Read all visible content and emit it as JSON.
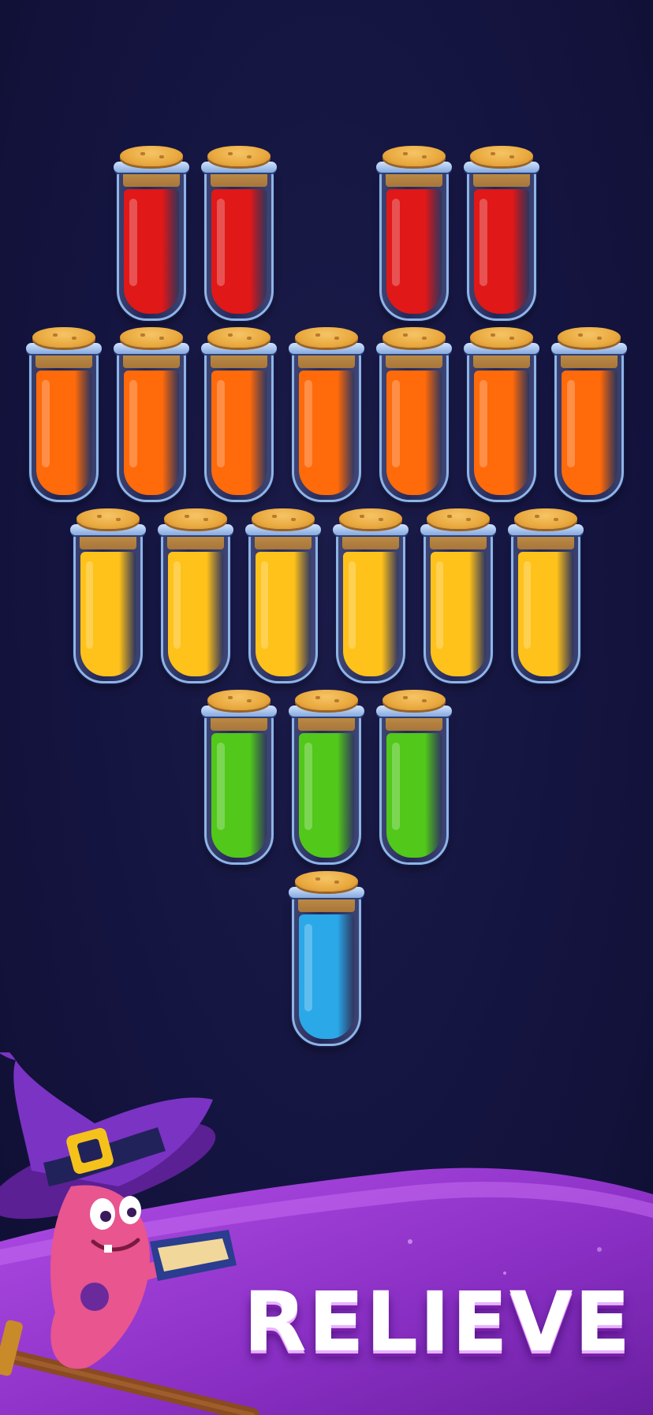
{
  "game": {
    "background_color": "#12123a",
    "tube_rows": [
      {
        "colors": [
          "#e01818",
          "#e01818",
          "#e01818",
          "#e01818"
        ],
        "gap_after_index": 1
      },
      {
        "colors": [
          "#ff6a0a",
          "#ff6a0a",
          "#ff6a0a",
          "#ff6a0a",
          "#ff6a0a",
          "#ff6a0a",
          "#ff6a0a"
        ]
      },
      {
        "colors": [
          "#ffc21a",
          "#ffc21a",
          "#ffc21a",
          "#ffc21a",
          "#ffc21a",
          "#ffc21a"
        ]
      },
      {
        "colors": [
          "#52c81a",
          "#52c81a",
          "#52c81a"
        ]
      },
      {
        "colors": [
          "#2ba8e8"
        ]
      }
    ],
    "fill_level": 0.88
  },
  "banner": {
    "slogan": "RELIEVE",
    "wave_color": "#8a2fc4",
    "wave_highlight": "#b04de6"
  },
  "mascot": {
    "name": "witch-character-icon",
    "hat_color": "#6a2aa8",
    "skin_color": "#e8558f",
    "buckle_color": "#f5c21b",
    "broom_color": "#8a4a22"
  }
}
